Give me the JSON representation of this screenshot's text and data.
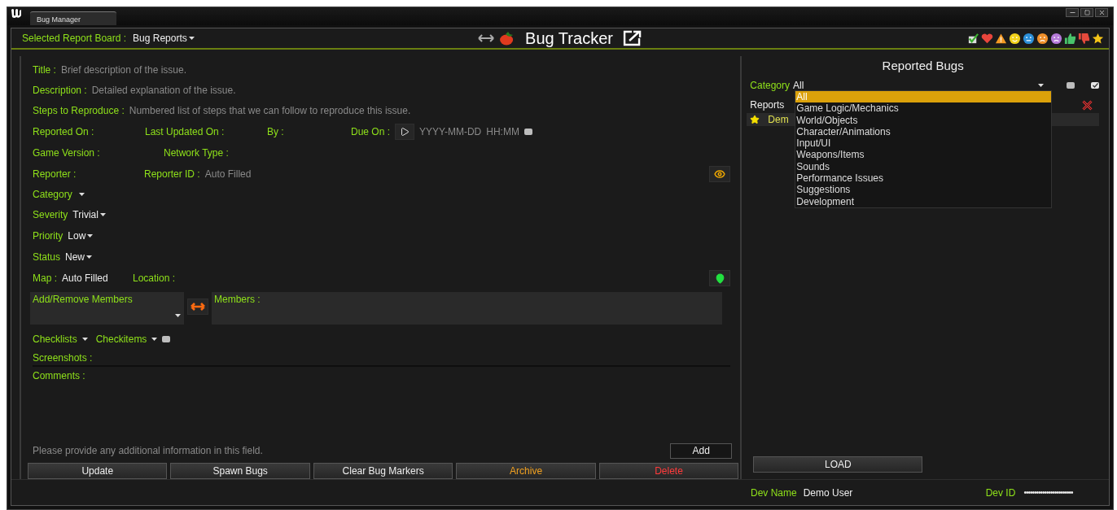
{
  "window": {
    "tab": "Bug Manager"
  },
  "header": {
    "board_label": "Selected Report Board :",
    "board_value": "Bug Reports",
    "title": "Bug Tracker"
  },
  "form": {
    "text_fields": [
      {
        "label": "Title :",
        "placeholder": "Brief description of the issue."
      },
      {
        "label": "Description :",
        "placeholder": "Detailed explanation of the issue."
      },
      {
        "label": "Steps to Reproduce :",
        "placeholder": "Numbered list of steps that we can follow to reproduce this issue."
      }
    ],
    "reported_on": "Reported On :",
    "last_updated_on": "Last Updated On :",
    "by": "By :",
    "due_on": {
      "label": "Due On :",
      "date_placeholder": "YYYY-MM-DD",
      "time_placeholder": "HH:MM",
      "checked": false
    },
    "game_version": "Game Version :",
    "network_type": "Network Type :",
    "reporter": "Reporter :",
    "reporter_id": {
      "label": "Reporter ID :",
      "value": "Auto Filled"
    },
    "selects": [
      {
        "label": "Category"
      },
      {
        "label": "Severity",
        "value": "Trivial"
      },
      {
        "label": "Priority",
        "value": "Low"
      },
      {
        "label": "Status",
        "value": "New"
      }
    ],
    "map": {
      "label": "Map :",
      "value": "Auto Filled"
    },
    "location": "Location :",
    "add_remove_members": "Add/Remove Members",
    "members": "Members :",
    "checklists": "Checklists",
    "checkitems": {
      "label": "Checkitems",
      "checked": false
    },
    "screenshots": "Screenshots :",
    "comments": {
      "label": "Comments :",
      "placeholder": "Please provide any additional information in this field.",
      "add_button": "Add"
    },
    "buttons": [
      {
        "label": "Update",
        "kind": "normal"
      },
      {
        "label": "Spawn Bugs",
        "kind": "normal"
      },
      {
        "label": "Clear Bug Markers",
        "kind": "normal"
      },
      {
        "label": "Archive",
        "kind": "warning"
      },
      {
        "label": "Delete",
        "kind": "danger"
      }
    ]
  },
  "reported_bugs": {
    "title": "Reported Bugs",
    "category_label": "Category",
    "category_value": "All",
    "filter_checks": [
      {
        "checked": false
      },
      {
        "checked": true
      }
    ],
    "reports_label": "Reports",
    "reports": [
      {
        "name": "Dem",
        "starred": true
      }
    ],
    "category_options": [
      {
        "label": "All",
        "selected": true
      },
      {
        "label": "Game Logic/Mechanics",
        "selected": false
      },
      {
        "label": "World/Objects",
        "selected": false
      },
      {
        "label": "Character/Animations",
        "selected": false
      },
      {
        "label": "Input/UI",
        "selected": false
      },
      {
        "label": "Weapons/Items",
        "selected": false
      },
      {
        "label": "Sounds",
        "selected": false
      },
      {
        "label": "Performance Issues",
        "selected": false
      },
      {
        "label": "Suggestions",
        "selected": false
      },
      {
        "label": "Development",
        "selected": false
      }
    ],
    "load_button": "LOAD"
  },
  "footer": {
    "dev_name_label": "Dev Name",
    "dev_name": "Demo User",
    "dev_id_label": "Dev ID",
    "dev_id": "••••••••••••••••••••••••"
  }
}
